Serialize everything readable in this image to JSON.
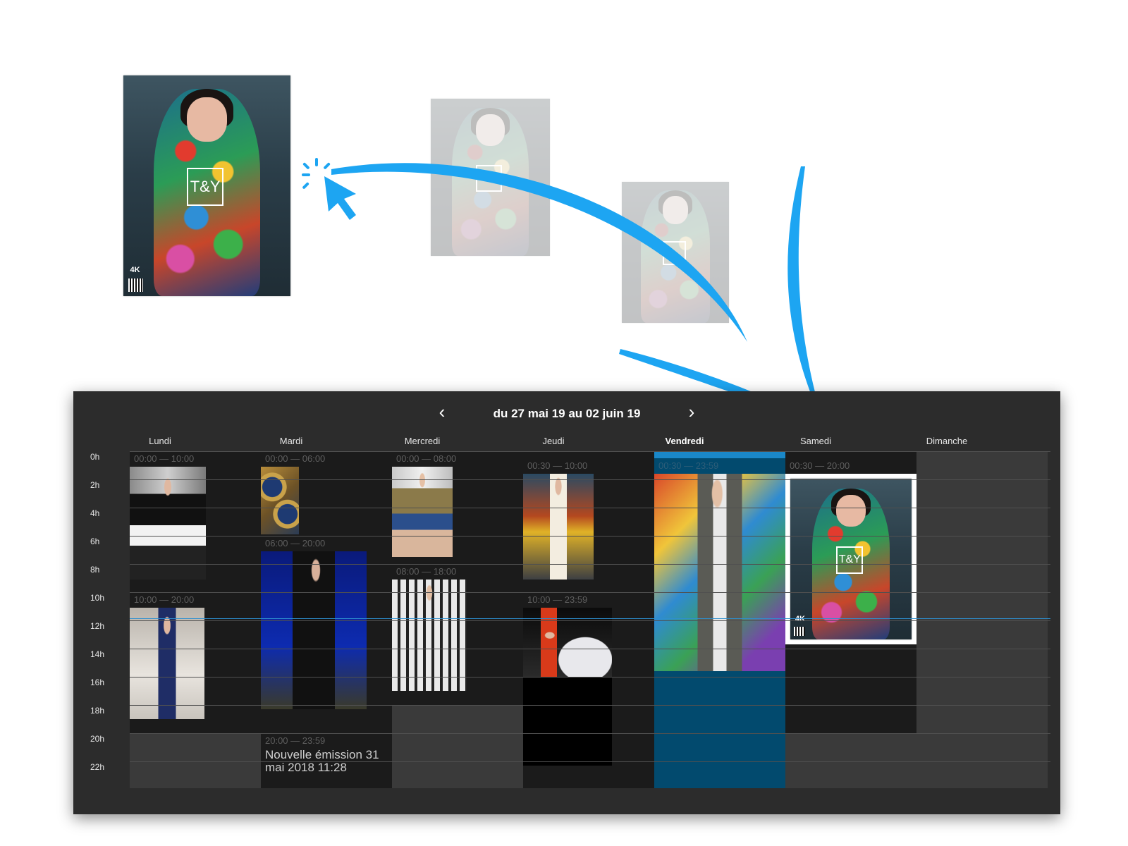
{
  "illustration": {
    "poster_logo": "T&Y",
    "poster_badge": "4K"
  },
  "calendar": {
    "title": "du 27 mai 19 au 02 juin 19",
    "prev_icon": "chevron-left-icon",
    "next_icon": "chevron-right-icon",
    "prev_glyph": "‹",
    "next_glyph": "›",
    "accent_color": "#1a88c9",
    "days": [
      {
        "label": "Lundi"
      },
      {
        "label": "Mardi"
      },
      {
        "label": "Mercredi"
      },
      {
        "label": "Jeudi"
      },
      {
        "label": "Vendredi",
        "active": true
      },
      {
        "label": "Samedi"
      },
      {
        "label": "Dimanche"
      }
    ],
    "hours": [
      "0h",
      "2h",
      "4h",
      "6h",
      "8h",
      "10h",
      "12h",
      "14h",
      "16h",
      "18h",
      "20h",
      "22h"
    ],
    "slots": {
      "lundi": [
        {
          "time": "00:00 — 10:00"
        },
        {
          "time": "10:00 — 20:00"
        }
      ],
      "mardi": [
        {
          "time": "00:00 — 06:00"
        },
        {
          "time": "06:00 — 20:00"
        },
        {
          "time": "20:00 — 23:59",
          "title": "Nouvelle émission 31 mai 2018 11:28"
        }
      ],
      "mercredi": [
        {
          "time": "00:00 — 08:00"
        },
        {
          "time": "08:00 — 18:00"
        }
      ],
      "jeudi": [
        {
          "time": "00:30 — 10:00"
        },
        {
          "time": "10:00 — 23:59"
        }
      ],
      "vendredi": [
        {
          "time": "00:30 — 23:59"
        }
      ],
      "samedi": [
        {
          "time": "00:30 — 20:00"
        }
      ]
    }
  }
}
